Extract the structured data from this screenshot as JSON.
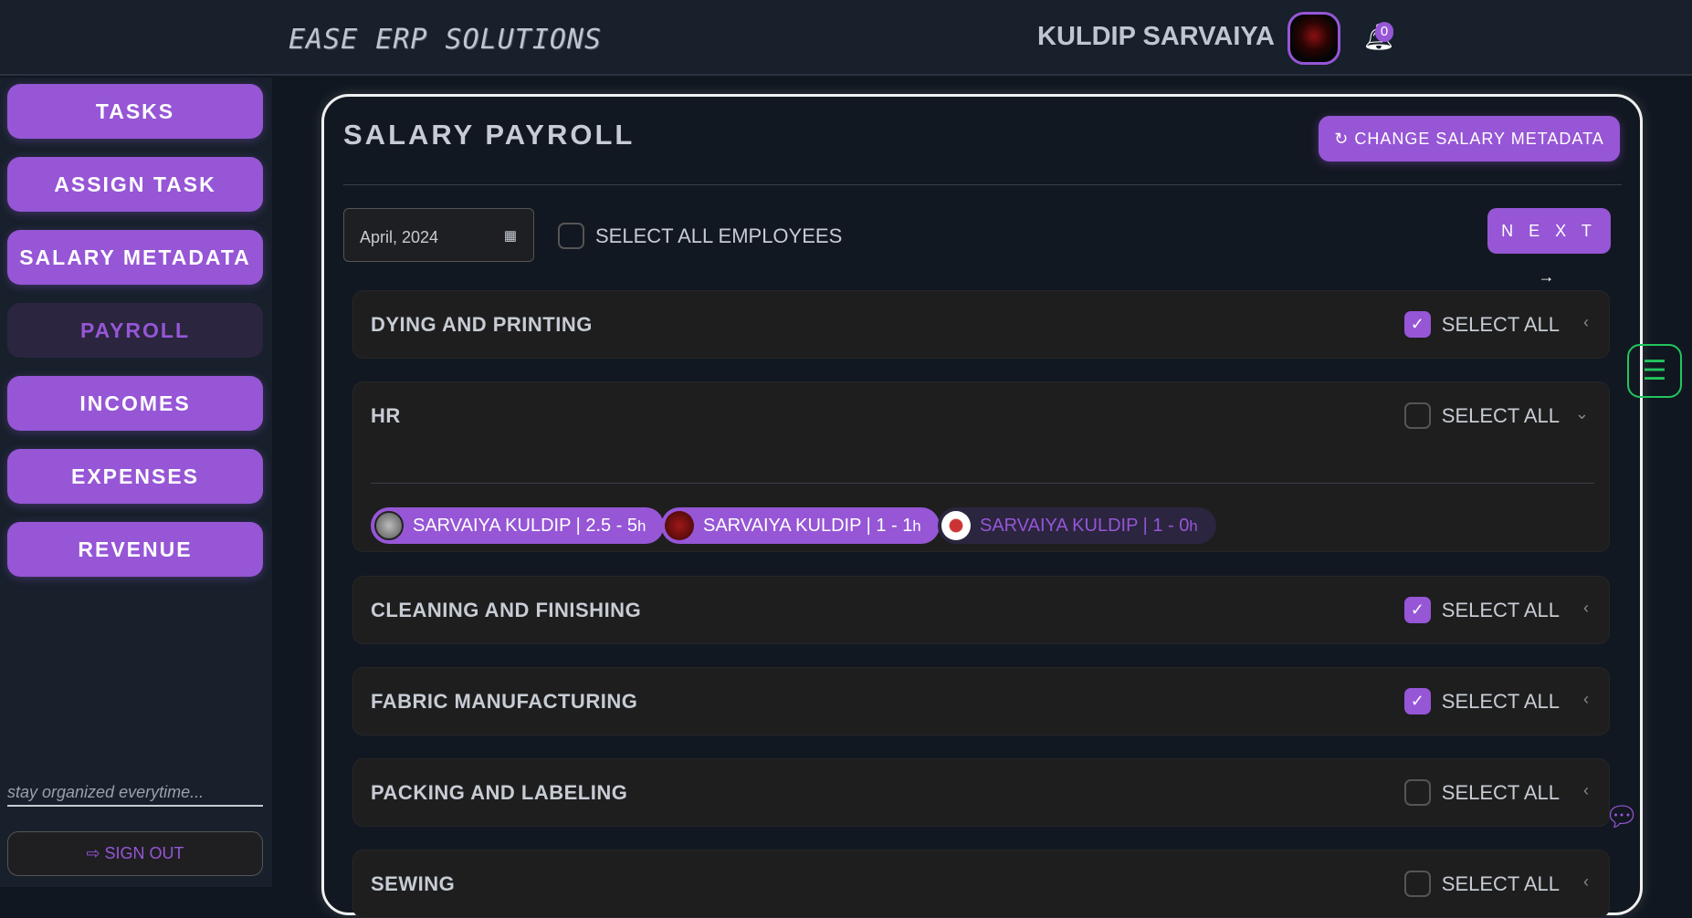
{
  "header": {
    "logo": "EASE ERP SOLUTIONS",
    "user_name": "KULDIP SARVAIYA",
    "notification_count": "0"
  },
  "sidebar": {
    "items": [
      {
        "label": "TASKS"
      },
      {
        "label": "ASSIGN TASK"
      },
      {
        "label": "SALARY METADATA"
      },
      {
        "label": "PAYROLL",
        "active": true
      },
      {
        "label": "INCOMES"
      },
      {
        "label": "EXPENSES"
      },
      {
        "label": "REVENUE"
      }
    ],
    "tagline": "stay organized everytime...",
    "sign_out": "SIGN OUT"
  },
  "main": {
    "title": "SALARY PAYROLL",
    "change_button": "CHANGE SALARY METADATA",
    "date_value": "April, 2024",
    "select_all_employees": "SELECT ALL EMPLOYEES",
    "select_all_checked": false,
    "next_button": "N E X T →",
    "sections": [
      {
        "name": "DYING AND PRINTING",
        "select_label": "SELECT ALL",
        "checked": true
      },
      {
        "name": "HR",
        "select_label": "SELECT ALL",
        "checked": false,
        "expanded": true,
        "employees": [
          {
            "label": "SARVAIYA KULDIP | 2.5 - 5",
            "unit": "h",
            "selected": true
          },
          {
            "label": "SARVAIYA KULDIP | 1 - 1",
            "unit": "h",
            "selected": true
          },
          {
            "label": "SARVAIYA KULDIP | 1 - 0",
            "unit": "h",
            "selected": false
          }
        ]
      },
      {
        "name": "CLEANING AND FINISHING",
        "select_label": "SELECT ALL",
        "checked": true
      },
      {
        "name": "FABRIC MANUFACTURING",
        "select_label": "SELECT ALL",
        "checked": true
      },
      {
        "name": "PACKING AND LABELING",
        "select_label": "SELECT ALL",
        "checked": false
      },
      {
        "name": "SEWING",
        "select_label": "SELECT ALL",
        "checked": false
      }
    ]
  },
  "colors": {
    "accent": "#9656d6",
    "background": "#111720",
    "card": "#1e1e1f",
    "float_icon": "#22c55e"
  }
}
